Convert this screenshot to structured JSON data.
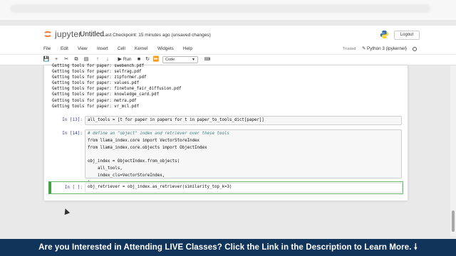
{
  "header": {
    "logo_text": "jupyter",
    "notebook_title": "Untitled",
    "checkpoint": "Last Checkpoint: 15 minutes ago",
    "unsaved": "(unsaved changes)",
    "logout_label": "Logout"
  },
  "menu": {
    "items": [
      "File",
      "Edit",
      "View",
      "Insert",
      "Cell",
      "Kernel",
      "Widgets",
      "Help"
    ],
    "trusted_label": "Trusted",
    "kernel_name": "Python 3 (ipykernel)"
  },
  "toolbar": {
    "run_label": "Run",
    "cell_type": "Code"
  },
  "output_lines": [
    "Getting tools for paper: swebench.pdf",
    "Getting tools for paper: selfrag.pdf",
    "Getting tools for paper: zipformer.pdf",
    "Getting tools for paper: values.pdf",
    "Getting tools for paper: finetune_fair_diffusion.pdf",
    "Getting tools for paper: knowledge_card.pdf",
    "Getting tools for paper: metra.pdf",
    "Getting tools for paper: vr_mcl.pdf"
  ],
  "cells": [
    {
      "prompt": "In [13]:",
      "lines": [
        "all_tools = [t for paper in papers for t in paper_to_tools_dict[paper]]"
      ]
    },
    {
      "prompt": "In [14]:",
      "lines": [
        "# define an \"object\" index and retriever over these tools",
        "from llama_index.core import VectorStoreIndex",
        "from llama_index.core.objects import ObjectIndex",
        "",
        "obj_index = ObjectIndex.from_objects(",
        "    all_tools,",
        "    index_cls=VectorStoreIndex,",
        ")"
      ]
    },
    {
      "prompt": "In [ ]:",
      "lines": [
        "obj_retriever = obj_index.as_retriever(similarity_top_k=3)"
      ]
    }
  ],
  "banner_text": "Are you Interested in Attending LIVE Classes? Click the Link in the Description to Learn More.",
  "colors": {
    "banner_bg": "#11345a",
    "prompt": "#303f9f",
    "active_cell": "#42a047",
    "logo": "#f37726"
  }
}
